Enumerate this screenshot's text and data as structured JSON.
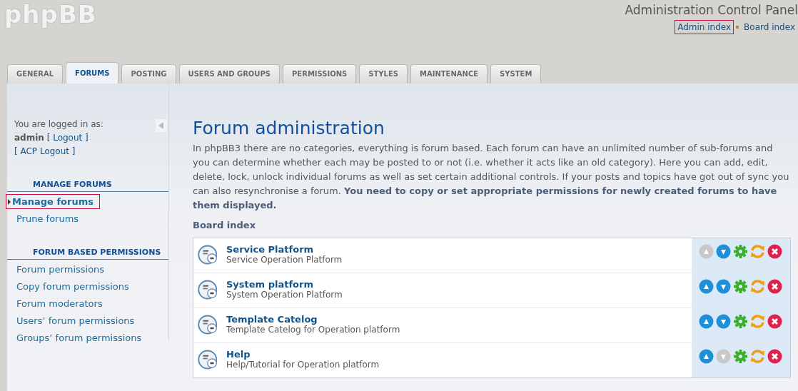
{
  "logo": "phpBB",
  "header": {
    "title": "Administration Control Panel",
    "links": [
      {
        "label": "Admin index",
        "highlighted": true
      },
      {
        "label": "Board index",
        "highlighted": false
      }
    ]
  },
  "tabs": [
    {
      "label": "GENERAL",
      "selected": false
    },
    {
      "label": "FORUMS",
      "selected": true
    },
    {
      "label": "POSTING",
      "selected": false
    },
    {
      "label": "USERS AND GROUPS",
      "selected": false
    },
    {
      "label": "PERMISSIONS",
      "selected": false
    },
    {
      "label": "STYLES",
      "selected": false
    },
    {
      "label": "MAINTENANCE",
      "selected": false
    },
    {
      "label": "SYSTEM",
      "selected": false
    }
  ],
  "sidebar": {
    "logged_in_label": "You are logged in as:",
    "username": "admin",
    "logout": "[ Logout ]",
    "acp_logout": "[ ACP Logout ]",
    "sections": [
      {
        "title": "MANAGE FORUMS",
        "items": [
          {
            "label": "Manage forums",
            "selected": true,
            "highlighted": true
          },
          {
            "label": "Prune forums",
            "selected": false,
            "highlighted": false
          }
        ]
      },
      {
        "title": "FORUM BASED PERMISSIONS",
        "items": [
          {
            "label": "Forum permissions",
            "selected": false,
            "highlighted": false
          },
          {
            "label": "Copy forum permissions",
            "selected": false,
            "highlighted": false
          },
          {
            "label": "Forum moderators",
            "selected": false,
            "highlighted": false
          },
          {
            "label": "Users’ forum permissions",
            "selected": false,
            "highlighted": false
          },
          {
            "label": "Groups’ forum permissions",
            "selected": false,
            "highlighted": false
          }
        ]
      }
    ]
  },
  "main": {
    "title": "Forum administration",
    "description": "In phpBB3 there are no categories, everything is forum based. Each forum can have an unlimited number of sub-forums and you can determine whether each may be posted to or not (i.e. whether it acts like an old category). Here you can add, edit, delete, lock, unlock individual forums as well as set certain additional controls. If your posts and topics have got out of sync you can also resynchronise a forum. **You need to copy or set appropriate permissions for newly created forums to have them displayed.**",
    "breadcrumb": "Board index",
    "forums": [
      {
        "name": "Service Platform",
        "description": "Service Operation Platform",
        "move_up_disabled": true,
        "move_down_disabled": false
      },
      {
        "name": "System platform",
        "description": "System Operation Platform",
        "move_up_disabled": false,
        "move_down_disabled": false
      },
      {
        "name": "Template Catelog",
        "description": "Template Catelog for Operation platform",
        "move_up_disabled": false,
        "move_down_disabled": false
      },
      {
        "name": "Help",
        "description": "Help/Tutorial for Operation platform",
        "move_up_disabled": false,
        "move_down_disabled": true
      }
    ]
  }
}
